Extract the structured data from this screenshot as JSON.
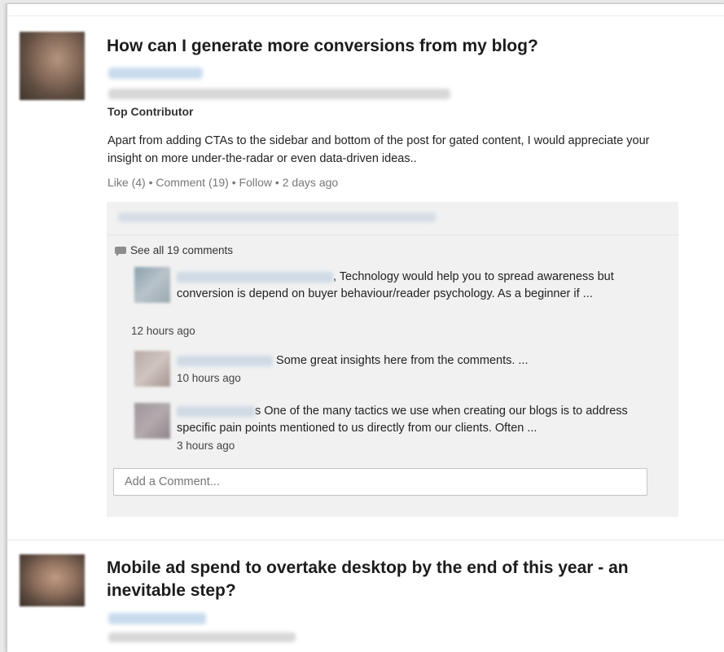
{
  "post1": {
    "title": "How can I generate more conversions from my blog?",
    "badge": "Top Contributor",
    "body": "Apart from adding CTAs to the sidebar and bottom of the post for gated content, I would appreciate your insight on more under-the-radar or even data-driven ideas..",
    "actions": {
      "like": "Like (4)",
      "sep1": " • ",
      "comment": "Comment (19)",
      "sep2": " • ",
      "follow": "Follow",
      "sep3": " • ",
      "time": "2 days ago"
    },
    "comments": {
      "see_all": "See all 19 comments",
      "items": [
        {
          "text": ", Technology would help you to spread awareness but conversion is depend on buyer behaviour/reader psychology. As a beginner if ...",
          "time": "12 hours ago"
        },
        {
          "text": " Some great insights here from the comments. ...",
          "time": "10 hours ago"
        },
        {
          "text": "s One of the many tactics we use when creating our blogs is to address specific pain points mentioned to us directly from our clients. Often ...",
          "time": "3 hours ago"
        }
      ],
      "add_placeholder": "Add a Comment..."
    }
  },
  "post2": {
    "title": "Mobile ad spend to overtake desktop by the end of this year - an inevitable step?"
  },
  "colors": {
    "link_blue": "#c9dcee",
    "panel_bg": "#f1f1f1",
    "meta_gray": "#777777"
  },
  "icons": {
    "comment": "speech-bubble-icon"
  }
}
